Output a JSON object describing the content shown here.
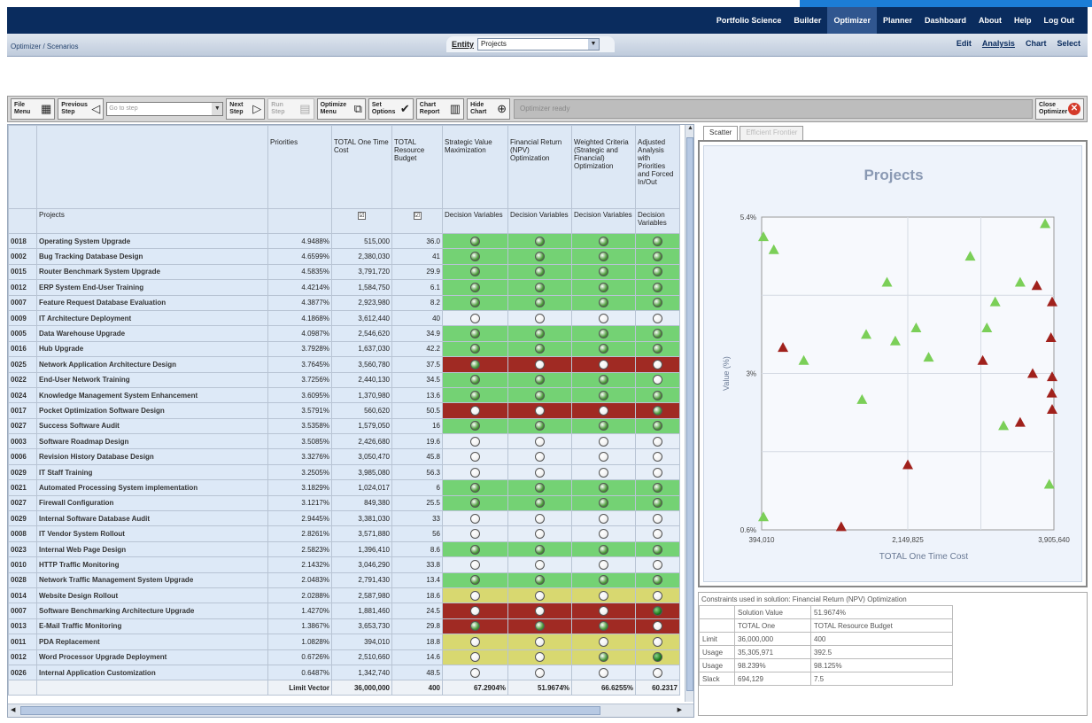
{
  "topnav": {
    "items": [
      "Portfolio Science",
      "Builder",
      "Optimizer",
      "Planner",
      "Dashboard",
      "About",
      "Help",
      "Log Out"
    ],
    "active": "Optimizer"
  },
  "subbar": {
    "breadcrumb": "Optimizer / Scenarios",
    "entity_label": "Entity",
    "entity_value": "Projects",
    "right_tabs": [
      "Edit",
      "Analysis",
      "Chart",
      "Select"
    ],
    "right_active": "Analysis"
  },
  "toolbar": {
    "file_menu": "File Menu",
    "previous_step": "Previous Step",
    "go_to_step_placeholder": "Go to step",
    "next_step": "Next Step",
    "disabled_btn": "Run Step",
    "optimize_menu": "Optimize Menu",
    "set_options": "Set Options",
    "chart_report": "Chart Report",
    "hide_chart": "Hide Chart",
    "message": "Optimizer ready",
    "close_optimizer": "Close Optimizer"
  },
  "grid": {
    "headers": {
      "priorities": "Priorities",
      "total_cost": "TOTAL One Time Cost",
      "total_budget": "TOTAL Resource Budget",
      "strategic": "Strategic Value Maximization",
      "financial": "Financial Return (NPV) Optimization",
      "weighted": "Weighted Criteria (Strategic and Financial) Optimization",
      "adjusted": "Adjusted Analysis with Priorities and Forced In/Out",
      "projects": "Projects",
      "decision": "Decision Variables"
    },
    "rows": [
      {
        "id": "0018",
        "name": "Operating System Upgrade",
        "pri": "4.9488%",
        "cost": "515,000",
        "bud": "36.0",
        "color": "green",
        "s": [
          "on",
          "on",
          "on",
          "on"
        ]
      },
      {
        "id": "0002",
        "name": "Bug Tracking Database Design",
        "pri": "4.6599%",
        "cost": "2,380,030",
        "bud": "41",
        "color": "green",
        "s": [
          "on",
          "on",
          "on",
          "on"
        ]
      },
      {
        "id": "0015",
        "name": "Router Benchmark System Upgrade",
        "pri": "4.5835%",
        "cost": "3,791,720",
        "bud": "29.9",
        "color": "green",
        "s": [
          "on",
          "on",
          "on",
          "on"
        ]
      },
      {
        "id": "0012",
        "name": "ERP System End-User Training",
        "pri": "4.4214%",
        "cost": "1,584,750",
        "bud": "6.1",
        "color": "green",
        "s": [
          "on",
          "on",
          "on",
          "on"
        ]
      },
      {
        "id": "0007",
        "name": "Feature Request Database Evaluation",
        "pri": "4.3877%",
        "cost": "2,923,980",
        "bud": "8.2",
        "color": "green",
        "s": [
          "on",
          "on",
          "on",
          "on"
        ]
      },
      {
        "id": "0009",
        "name": "IT Architecture Deployment",
        "pri": "4.1868%",
        "cost": "3,612,440",
        "bud": "40",
        "color": "white",
        "s": [
          "off",
          "off",
          "off",
          "off"
        ]
      },
      {
        "id": "0005",
        "name": "Data Warehouse Upgrade",
        "pri": "4.0987%",
        "cost": "2,546,620",
        "bud": "34.9",
        "color": "green",
        "s": [
          "on",
          "on",
          "on",
          "on"
        ]
      },
      {
        "id": "0016",
        "name": "Hub Upgrade",
        "pri": "3.7928%",
        "cost": "1,637,030",
        "bud": "42.2",
        "color": "green",
        "s": [
          "on",
          "on",
          "on",
          "on"
        ]
      },
      {
        "id": "0025",
        "name": "Network Application Architecture Design",
        "pri": "3.7645%",
        "cost": "3,560,780",
        "bud": "37.5",
        "color": "red",
        "s": [
          "on",
          "off",
          "off",
          "off"
        ]
      },
      {
        "id": "0022",
        "name": "End-User Network Training",
        "pri": "3.7256%",
        "cost": "2,440,130",
        "bud": "34.5",
        "color": "green",
        "s": [
          "on",
          "on",
          "on",
          "off"
        ]
      },
      {
        "id": "0024",
        "name": "Knowledge Management System Enhancement",
        "pri": "3.6095%",
        "cost": "1,370,980",
        "bud": "13.6",
        "color": "green",
        "s": [
          "on",
          "on",
          "on",
          "on"
        ]
      },
      {
        "id": "0017",
        "name": "Pocket Optimization Software Design",
        "pri": "3.5791%",
        "cost": "560,620",
        "bud": "50.5",
        "color": "red",
        "s": [
          "off",
          "off",
          "off",
          "on"
        ]
      },
      {
        "id": "0027",
        "name": "Success Software Audit",
        "pri": "3.5358%",
        "cost": "1,579,050",
        "bud": "16",
        "color": "green",
        "s": [
          "on",
          "on",
          "on",
          "on"
        ]
      },
      {
        "id": "0003",
        "name": "Software Roadmap Design",
        "pri": "3.5085%",
        "cost": "2,426,680",
        "bud": "19.6",
        "color": "white",
        "s": [
          "off",
          "off",
          "off",
          "off"
        ]
      },
      {
        "id": "0006",
        "name": "Revision History Database Design",
        "pri": "3.3276%",
        "cost": "3,050,470",
        "bud": "45.8",
        "color": "white",
        "s": [
          "off",
          "off",
          "off",
          "off"
        ]
      },
      {
        "id": "0029",
        "name": "IT Staff Training",
        "pri": "3.2505%",
        "cost": "3,985,080",
        "bud": "56.3",
        "color": "white",
        "s": [
          "off",
          "off",
          "off",
          "off"
        ]
      },
      {
        "id": "0021",
        "name": "Automated Processing System implementation",
        "pri": "3.1829%",
        "cost": "1,024,017",
        "bud": "6",
        "color": "green",
        "s": [
          "on",
          "on",
          "on",
          "on"
        ]
      },
      {
        "id": "0027",
        "name": "Firewall Configuration",
        "pri": "3.1217%",
        "cost": "849,380",
        "bud": "25.5",
        "color": "green",
        "s": [
          "on",
          "on",
          "on",
          "on"
        ]
      },
      {
        "id": "0029",
        "name": "Internal Software Database Audit",
        "pri": "2.9445%",
        "cost": "3,381,030",
        "bud": "33",
        "color": "white",
        "s": [
          "off",
          "off",
          "off",
          "off"
        ]
      },
      {
        "id": "0008",
        "name": "IT Vendor System Rollout",
        "pri": "2.8261%",
        "cost": "3,571,880",
        "bud": "56",
        "color": "white",
        "s": [
          "off",
          "off",
          "off",
          "off"
        ]
      },
      {
        "id": "0023",
        "name": "Internal Web Page Design",
        "pri": "2.5823%",
        "cost": "1,396,410",
        "bud": "8.6",
        "color": "green",
        "s": [
          "on",
          "on",
          "on",
          "on"
        ]
      },
      {
        "id": "0010",
        "name": "HTTP Traffic Monitoring",
        "pri": "2.1432%",
        "cost": "3,046,290",
        "bud": "33.8",
        "color": "white",
        "s": [
          "off",
          "off",
          "off",
          "off"
        ]
      },
      {
        "id": "0028",
        "name": "Network Traffic Management System Upgrade",
        "pri": "2.0483%",
        "cost": "2,791,430",
        "bud": "13.4",
        "color": "green",
        "s": [
          "on",
          "on",
          "on",
          "on"
        ]
      },
      {
        "id": "0014",
        "name": "Website Design Rollout",
        "pri": "2.0288%",
        "cost": "2,587,980",
        "bud": "18.6",
        "color": "yellow",
        "s": [
          "off",
          "off",
          "off",
          "off"
        ]
      },
      {
        "id": "0007",
        "name": "Software Benchmarking Architecture Upgrade",
        "pri": "1.4270%",
        "cost": "1,881,460",
        "bud": "24.5",
        "color": "red",
        "s": [
          "off",
          "off",
          "off",
          "dark"
        ]
      },
      {
        "id": "0013",
        "name": "E-Mail Traffic Monitoring",
        "pri": "1.3867%",
        "cost": "3,653,730",
        "bud": "29.8",
        "color": "red",
        "s": [
          "on",
          "on",
          "on",
          "off"
        ]
      },
      {
        "id": "0011",
        "name": "PDA Replacement",
        "pri": "1.0828%",
        "cost": "394,010",
        "bud": "18.8",
        "color": "yellow",
        "s": [
          "off",
          "off",
          "off",
          "off"
        ]
      },
      {
        "id": "0012",
        "name": "Word Processor Upgrade Deployment",
        "pri": "0.6726%",
        "cost": "2,510,660",
        "bud": "14.6",
        "color": "yellow",
        "s": [
          "off",
          "off",
          "on",
          "dark"
        ]
      },
      {
        "id": "0026",
        "name": "Internal Application Customization",
        "pri": "0.6487%",
        "cost": "1,342,740",
        "bud": "48.5",
        "color": "white",
        "s": [
          "off",
          "off",
          "off",
          "off"
        ]
      }
    ],
    "footer": {
      "label": "Limit Vector",
      "cost": "36,000,000",
      "bud": "400",
      "s": "67.2904%",
      "f": "51.9674%",
      "w": "66.6255%",
      "a": "60.2317"
    }
  },
  "chart_tabs": {
    "scatter": "Scatter",
    "frontier": "Efficient Frontier"
  },
  "chart_data": {
    "type": "scatter",
    "title": "Projects",
    "xlabel": "TOTAL One Time Cost",
    "ylabel": "Value (%)",
    "x_ticks": [
      "394,010",
      "2,149,825",
      "3,905,640"
    ],
    "y_ticks": [
      "5.4%",
      "3%",
      "0.6%"
    ],
    "xlim": [
      394010,
      3905640
    ],
    "ylim": [
      0.6,
      5.4
    ],
    "grid": true,
    "series": [
      {
        "color": "#7bcf58",
        "points": [
          [
            394010,
            5.1
          ],
          [
            540000,
            4.9
          ],
          [
            900000,
            3.2
          ],
          [
            1600000,
            2.6
          ],
          [
            1650000,
            3.6
          ],
          [
            1900000,
            4.4
          ],
          [
            2000000,
            3.5
          ],
          [
            2250000,
            3.7
          ],
          [
            2400000,
            3.25
          ],
          [
            2900000,
            4.8
          ],
          [
            3100000,
            3.7
          ],
          [
            3200000,
            4.1
          ],
          [
            3300000,
            2.2
          ],
          [
            3500000,
            4.4
          ],
          [
            3800000,
            5.3
          ],
          [
            3850000,
            1.3
          ],
          [
            394010,
            0.8
          ]
        ]
      },
      {
        "color": "#a0211c",
        "points": [
          [
            650000,
            3.4
          ],
          [
            1350000,
            0.65
          ],
          [
            2150000,
            1.6
          ],
          [
            3050000,
            3.2
          ],
          [
            3500000,
            2.25
          ],
          [
            3650000,
            3.0
          ],
          [
            3700000,
            4.35
          ],
          [
            3870000,
            3.55
          ],
          [
            3880000,
            2.7
          ],
          [
            3930000,
            4.1
          ],
          [
            3950000,
            2.45
          ],
          [
            4050000,
            2.95
          ]
        ]
      }
    ]
  },
  "constraints": {
    "caption": "Constraints used in solution: Financial Return (NPV) Optimization",
    "rows": [
      [
        "",
        "Solution Value",
        "51.9674%"
      ],
      [
        "",
        "TOTAL One",
        "TOTAL Resource Budget"
      ],
      [
        "Limit",
        "36,000,000",
        "400"
      ],
      [
        "Usage",
        "35,305,971",
        "392.5"
      ],
      [
        "Usage",
        "98.239%",
        "98.125%"
      ],
      [
        "Slack",
        "694,129",
        "7.5"
      ]
    ]
  }
}
